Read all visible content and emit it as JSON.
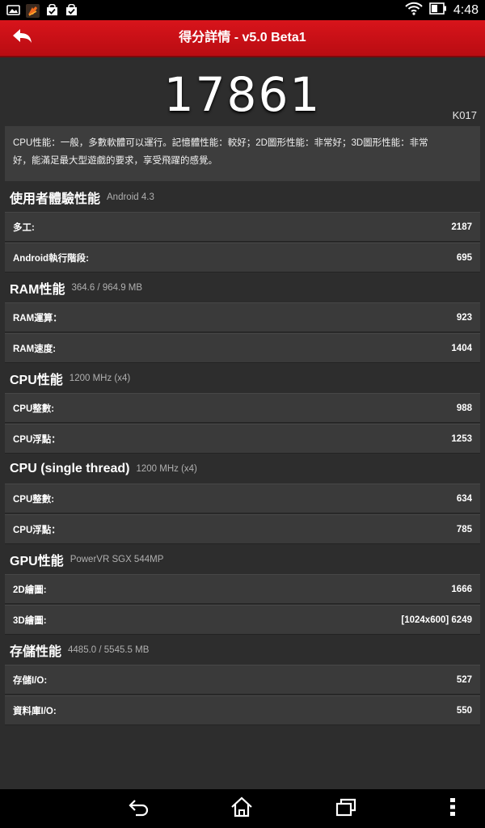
{
  "status_bar": {
    "time": "4:48",
    "left_icons": [
      "image-icon",
      "app-icon",
      "shopping-bag-icon",
      "shopping-bag-icon"
    ],
    "right_icons": [
      "wifi-icon",
      "battery-icon"
    ]
  },
  "title_bar": {
    "title": "得分詳情 - v5.0 Beta1",
    "back_icon": "back-arrow-icon"
  },
  "score": {
    "total": "17861",
    "device": "K017",
    "description_line1": "CPU性能：一般，多數軟體可以運行。記憶體性能：較好；2D圖形性能：非常好；3D圖形性能：非常",
    "description_line2": "好，能滿足最大型遊戲的要求，享受飛躍的感覺。"
  },
  "sections": [
    {
      "title": "使用者體驗性能",
      "subtitle": "Android 4.3",
      "rows": [
        {
          "label": "多工:",
          "value": "2187"
        },
        {
          "label": "Android執行階段:",
          "value": "695"
        }
      ]
    },
    {
      "title": "RAM性能",
      "subtitle": "364.6 / 964.9 MB",
      "rows": [
        {
          "label": "RAM運算：",
          "value": "923"
        },
        {
          "label": "RAM速度:",
          "value": "1404"
        }
      ]
    },
    {
      "title": "CPU性能",
      "subtitle": "1200 MHz (x4)",
      "rows": [
        {
          "label": "CPU整數:",
          "value": "988"
        },
        {
          "label": "CPU浮點：",
          "value": "1253"
        }
      ]
    },
    {
      "title": "CPU (single thread)",
      "subtitle": "1200 MHz (x4)",
      "rows": [
        {
          "label": "CPU整數:",
          "value": "634"
        },
        {
          "label": "CPU浮點：",
          "value": "785"
        }
      ]
    },
    {
      "title": "GPU性能",
      "subtitle": "PowerVR SGX 544MP",
      "rows": [
        {
          "label": "2D繪圖:",
          "value": "1666"
        },
        {
          "label": "3D繪圖:",
          "value": "[1024x600] 6249"
        }
      ]
    },
    {
      "title": "存儲性能",
      "subtitle": "4485.0 / 5545.5 MB",
      "rows": [
        {
          "label": "存儲I/O:",
          "value": "527"
        },
        {
          "label": "資料庫I/O:",
          "value": "550"
        }
      ]
    }
  ],
  "nav_bar": {
    "icons": [
      "back-icon",
      "home-icon",
      "recent-apps-icon",
      "overflow-menu-icon"
    ]
  },
  "colors": {
    "title_bar": "#c8121a",
    "background": "#2d2d2d",
    "row_background": "#3a3a3a"
  }
}
